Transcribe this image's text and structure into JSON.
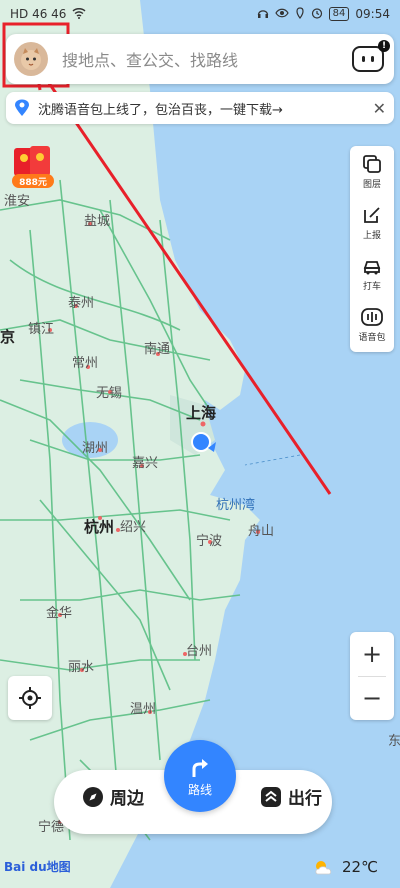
{
  "status_bar": {
    "left": "HD 46 46",
    "right_time": "09:54",
    "battery": "84"
  },
  "search": {
    "placeholder": "搜地点、查公交、找路线"
  },
  "notice": {
    "text": "沈腾语音包上线了，包治百丧，一键下载→"
  },
  "red_packet": {
    "label": "888元"
  },
  "tools": {
    "layers": "图层",
    "report": "上报",
    "taxi": "打车",
    "voice_pack": "语音包"
  },
  "zoom": {
    "in": "+",
    "out": "−"
  },
  "bottom_bar": {
    "nearby": "周边",
    "route": "路线",
    "travel": "出行"
  },
  "weather": {
    "temp": "22℃"
  },
  "logo": "Bai du地图",
  "map_labels": {
    "huaian": "淮安",
    "yancheng": "盐城",
    "taizhou_js": "泰州",
    "zhenjiang": "镇江",
    "nanjing_partial": "京",
    "changzhou": "常州",
    "nantong": "南通",
    "wuxi": "无锡",
    "shanghai": "上海",
    "huzhou": "湖州",
    "jiaxing": "嘉兴",
    "hangzhouwan": "杭州湾",
    "hangzhou": "杭州",
    "shaoxing": "绍兴",
    "zhoushan": "舟山",
    "ningbo": "宁波",
    "jinhua": "金华",
    "taizhou_zj": "台州",
    "lishui": "丽水",
    "wenzhou": "温州",
    "ningde_partial": "宁德",
    "dong_partial": "东"
  },
  "colors": {
    "sea": "#a9d3f5",
    "land": "#dcefe3",
    "highway": "#5bbf84",
    "accent_blue": "#3385ff",
    "annotation_red": "#e8202a"
  }
}
